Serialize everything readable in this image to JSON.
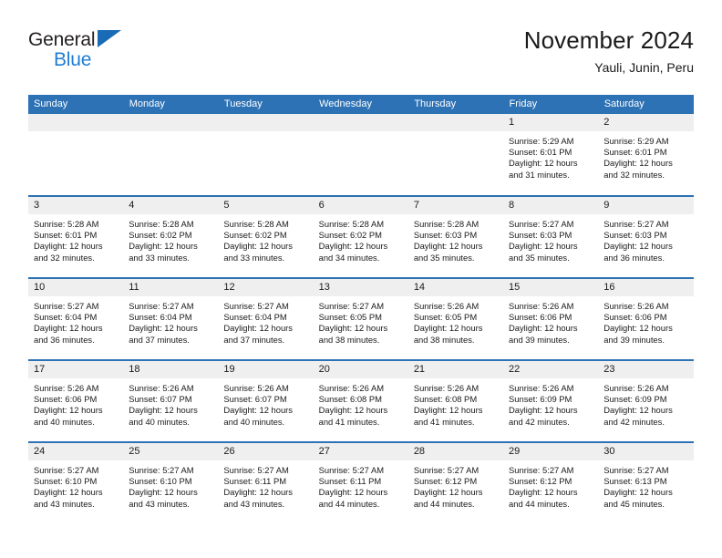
{
  "brand": {
    "name_dark": "General",
    "name_blue": "Blue",
    "color_dark": "#231f20",
    "color_blue": "#1f7dd4",
    "triangle_color": "#1a6bb5"
  },
  "header": {
    "title": "November 2024",
    "subtitle": "Yauli, Junin, Peru"
  },
  "theme": {
    "header_blue": "#2d72b5",
    "day_band_gray": "#efefef",
    "text": "#1a1a1a"
  },
  "calendar": {
    "weekday_headers": [
      "Sunday",
      "Monday",
      "Tuesday",
      "Wednesday",
      "Thursday",
      "Friday",
      "Saturday"
    ],
    "weeks": [
      [
        {
          "day": "",
          "blank": true
        },
        {
          "day": "",
          "blank": true
        },
        {
          "day": "",
          "blank": true
        },
        {
          "day": "",
          "blank": true
        },
        {
          "day": "",
          "blank": true
        },
        {
          "day": "1",
          "sunrise": "Sunrise: 5:29 AM",
          "sunset": "Sunset: 6:01 PM",
          "daylight1": "Daylight: 12 hours",
          "daylight2": "and 31 minutes."
        },
        {
          "day": "2",
          "sunrise": "Sunrise: 5:29 AM",
          "sunset": "Sunset: 6:01 PM",
          "daylight1": "Daylight: 12 hours",
          "daylight2": "and 32 minutes."
        }
      ],
      [
        {
          "day": "3",
          "sunrise": "Sunrise: 5:28 AM",
          "sunset": "Sunset: 6:01 PM",
          "daylight1": "Daylight: 12 hours",
          "daylight2": "and 32 minutes."
        },
        {
          "day": "4",
          "sunrise": "Sunrise: 5:28 AM",
          "sunset": "Sunset: 6:02 PM",
          "daylight1": "Daylight: 12 hours",
          "daylight2": "and 33 minutes."
        },
        {
          "day": "5",
          "sunrise": "Sunrise: 5:28 AM",
          "sunset": "Sunset: 6:02 PM",
          "daylight1": "Daylight: 12 hours",
          "daylight2": "and 33 minutes."
        },
        {
          "day": "6",
          "sunrise": "Sunrise: 5:28 AM",
          "sunset": "Sunset: 6:02 PM",
          "daylight1": "Daylight: 12 hours",
          "daylight2": "and 34 minutes."
        },
        {
          "day": "7",
          "sunrise": "Sunrise: 5:28 AM",
          "sunset": "Sunset: 6:03 PM",
          "daylight1": "Daylight: 12 hours",
          "daylight2": "and 35 minutes."
        },
        {
          "day": "8",
          "sunrise": "Sunrise: 5:27 AM",
          "sunset": "Sunset: 6:03 PM",
          "daylight1": "Daylight: 12 hours",
          "daylight2": "and 35 minutes."
        },
        {
          "day": "9",
          "sunrise": "Sunrise: 5:27 AM",
          "sunset": "Sunset: 6:03 PM",
          "daylight1": "Daylight: 12 hours",
          "daylight2": "and 36 minutes."
        }
      ],
      [
        {
          "day": "10",
          "sunrise": "Sunrise: 5:27 AM",
          "sunset": "Sunset: 6:04 PM",
          "daylight1": "Daylight: 12 hours",
          "daylight2": "and 36 minutes."
        },
        {
          "day": "11",
          "sunrise": "Sunrise: 5:27 AM",
          "sunset": "Sunset: 6:04 PM",
          "daylight1": "Daylight: 12 hours",
          "daylight2": "and 37 minutes."
        },
        {
          "day": "12",
          "sunrise": "Sunrise: 5:27 AM",
          "sunset": "Sunset: 6:04 PM",
          "daylight1": "Daylight: 12 hours",
          "daylight2": "and 37 minutes."
        },
        {
          "day": "13",
          "sunrise": "Sunrise: 5:27 AM",
          "sunset": "Sunset: 6:05 PM",
          "daylight1": "Daylight: 12 hours",
          "daylight2": "and 38 minutes."
        },
        {
          "day": "14",
          "sunrise": "Sunrise: 5:26 AM",
          "sunset": "Sunset: 6:05 PM",
          "daylight1": "Daylight: 12 hours",
          "daylight2": "and 38 minutes."
        },
        {
          "day": "15",
          "sunrise": "Sunrise: 5:26 AM",
          "sunset": "Sunset: 6:06 PM",
          "daylight1": "Daylight: 12 hours",
          "daylight2": "and 39 minutes."
        },
        {
          "day": "16",
          "sunrise": "Sunrise: 5:26 AM",
          "sunset": "Sunset: 6:06 PM",
          "daylight1": "Daylight: 12 hours",
          "daylight2": "and 39 minutes."
        }
      ],
      [
        {
          "day": "17",
          "sunrise": "Sunrise: 5:26 AM",
          "sunset": "Sunset: 6:06 PM",
          "daylight1": "Daylight: 12 hours",
          "daylight2": "and 40 minutes."
        },
        {
          "day": "18",
          "sunrise": "Sunrise: 5:26 AM",
          "sunset": "Sunset: 6:07 PM",
          "daylight1": "Daylight: 12 hours",
          "daylight2": "and 40 minutes."
        },
        {
          "day": "19",
          "sunrise": "Sunrise: 5:26 AM",
          "sunset": "Sunset: 6:07 PM",
          "daylight1": "Daylight: 12 hours",
          "daylight2": "and 40 minutes."
        },
        {
          "day": "20",
          "sunrise": "Sunrise: 5:26 AM",
          "sunset": "Sunset: 6:08 PM",
          "daylight1": "Daylight: 12 hours",
          "daylight2": "and 41 minutes."
        },
        {
          "day": "21",
          "sunrise": "Sunrise: 5:26 AM",
          "sunset": "Sunset: 6:08 PM",
          "daylight1": "Daylight: 12 hours",
          "daylight2": "and 41 minutes."
        },
        {
          "day": "22",
          "sunrise": "Sunrise: 5:26 AM",
          "sunset": "Sunset: 6:09 PM",
          "daylight1": "Daylight: 12 hours",
          "daylight2": "and 42 minutes."
        },
        {
          "day": "23",
          "sunrise": "Sunrise: 5:26 AM",
          "sunset": "Sunset: 6:09 PM",
          "daylight1": "Daylight: 12 hours",
          "daylight2": "and 42 minutes."
        }
      ],
      [
        {
          "day": "24",
          "sunrise": "Sunrise: 5:27 AM",
          "sunset": "Sunset: 6:10 PM",
          "daylight1": "Daylight: 12 hours",
          "daylight2": "and 43 minutes."
        },
        {
          "day": "25",
          "sunrise": "Sunrise: 5:27 AM",
          "sunset": "Sunset: 6:10 PM",
          "daylight1": "Daylight: 12 hours",
          "daylight2": "and 43 minutes."
        },
        {
          "day": "26",
          "sunrise": "Sunrise: 5:27 AM",
          "sunset": "Sunset: 6:11 PM",
          "daylight1": "Daylight: 12 hours",
          "daylight2": "and 43 minutes."
        },
        {
          "day": "27",
          "sunrise": "Sunrise: 5:27 AM",
          "sunset": "Sunset: 6:11 PM",
          "daylight1": "Daylight: 12 hours",
          "daylight2": "and 44 minutes."
        },
        {
          "day": "28",
          "sunrise": "Sunrise: 5:27 AM",
          "sunset": "Sunset: 6:12 PM",
          "daylight1": "Daylight: 12 hours",
          "daylight2": "and 44 minutes."
        },
        {
          "day": "29",
          "sunrise": "Sunrise: 5:27 AM",
          "sunset": "Sunset: 6:12 PM",
          "daylight1": "Daylight: 12 hours",
          "daylight2": "and 44 minutes."
        },
        {
          "day": "30",
          "sunrise": "Sunrise: 5:27 AM",
          "sunset": "Sunset: 6:13 PM",
          "daylight1": "Daylight: 12 hours",
          "daylight2": "and 45 minutes."
        }
      ]
    ]
  }
}
